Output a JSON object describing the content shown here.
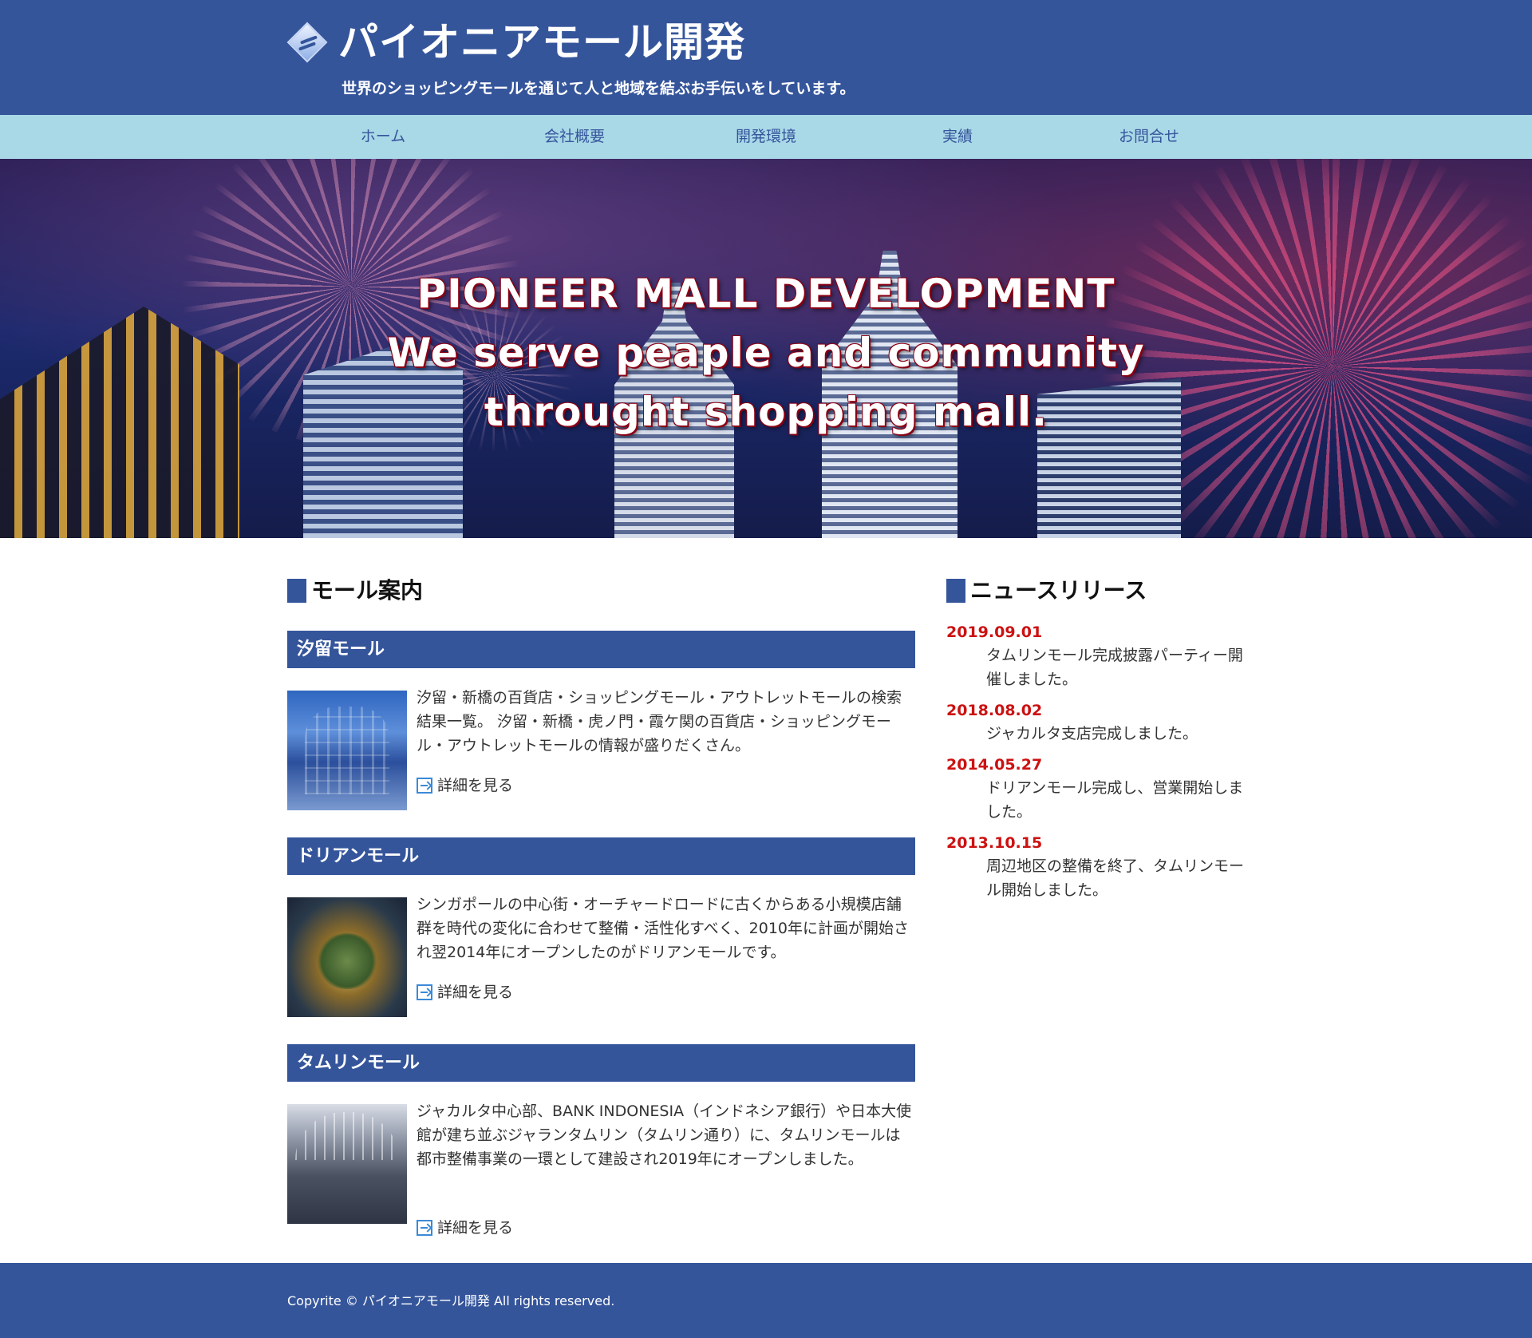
{
  "header": {
    "title": "パイオニアモール開発",
    "tagline": "世界のショッピングモールを通じて人と地域を結ぶお手伝いをしています。"
  },
  "nav": {
    "items": [
      {
        "label": "ホーム"
      },
      {
        "label": "会社概要"
      },
      {
        "label": "開発環境"
      },
      {
        "label": "実績"
      },
      {
        "label": "お問合せ"
      }
    ]
  },
  "hero": {
    "line1": "PIONEER MALL DEVELOPMENT",
    "line2": "We serve peaple and community",
    "line3": "throught shopping mall."
  },
  "mall_section": {
    "title": "モール案内",
    "more_label": "詳細を見る",
    "malls": [
      {
        "name": "汐留モール",
        "description": "汐留・新橋の百貨店・ショッピングモール・アウトレットモールの検索結果一覧。 汐留・新橋・虎ノ門・霞ケ関の百貨店・ショッピングモール・アウトレットモールの情報が盛りだくさん。"
      },
      {
        "name": "ドリアンモール",
        "description": "シンガポールの中心街・オーチャードロードに古くからある小規模店舗群を時代の変化に合わせて整備・活性化すべく、2010年に計画が開始され翌2014年にオープンしたのがドリアンモールです。"
      },
      {
        "name": "タムリンモール",
        "description": "ジャカルタ中心部、BANK INDONESIA（インドネシア銀行）や日本大使館が建ち並ぶジャランタムリン（タムリン通り）に、タムリンモールは都市整備事業の一環として建設され2019年にオープンしました。"
      }
    ]
  },
  "news_section": {
    "title": "ニュースリリース",
    "items": [
      {
        "date": "2019.09.01",
        "text": "タムリンモール完成披露パーティー開催しました。"
      },
      {
        "date": "2018.08.02",
        "text": "ジャカルタ支店完成しました。"
      },
      {
        "date": "2014.05.27",
        "text": "ドリアンモール完成し、営業開始しました。"
      },
      {
        "date": "2013.10.15",
        "text": "周辺地区の整備を終了、タムリンモール開始しました。"
      }
    ]
  },
  "footer": {
    "copyright": "Copyrite © パイオニアモール開発 All rights reserved."
  },
  "colors": {
    "primary": "#35559b",
    "nav_bg": "#a9d8e7",
    "date_red": "#cc1111"
  }
}
